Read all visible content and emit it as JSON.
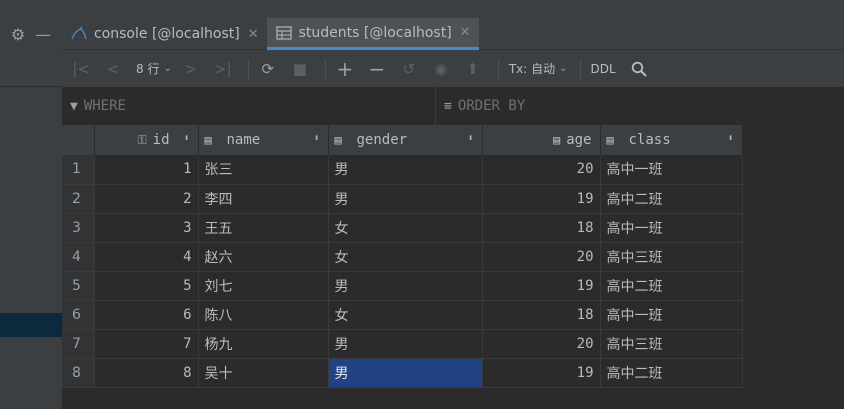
{
  "tabs": [
    {
      "label": "console [@localhost]",
      "icon": "mysql-icon",
      "active": false
    },
    {
      "label": "students [@localhost]",
      "icon": "table-icon",
      "active": true
    }
  ],
  "toolbar": {
    "rows_label": "8 行",
    "tx_label": "Tx: 自动",
    "ddl_label": "DDL"
  },
  "filter": {
    "where_label": "WHERE",
    "order_label": "ORDER BY"
  },
  "grid": {
    "columns": [
      "id",
      "name",
      "gender",
      "age",
      "class"
    ],
    "rows": [
      {
        "num": "1",
        "id": "1",
        "name": "张三",
        "gender": "男",
        "age": "20",
        "class": "高中一班"
      },
      {
        "num": "2",
        "id": "2",
        "name": "李四",
        "gender": "男",
        "age": "19",
        "class": "高中二班"
      },
      {
        "num": "3",
        "id": "3",
        "name": "王五",
        "gender": "女",
        "age": "18",
        "class": "高中一班"
      },
      {
        "num": "4",
        "id": "4",
        "name": "赵六",
        "gender": "女",
        "age": "20",
        "class": "高中三班"
      },
      {
        "num": "5",
        "id": "5",
        "name": "刘七",
        "gender": "男",
        "age": "19",
        "class": "高中二班"
      },
      {
        "num": "6",
        "id": "6",
        "name": "陈八",
        "gender": "女",
        "age": "18",
        "class": "高中一班"
      },
      {
        "num": "7",
        "id": "7",
        "name": "杨九",
        "gender": "男",
        "age": "20",
        "class": "高中三班"
      },
      {
        "num": "8",
        "id": "8",
        "name": "吴十",
        "gender": "男",
        "age": "19",
        "class": "高中二班"
      }
    ]
  },
  "colors": {
    "accent": "#4a88c7",
    "selection": "#214283",
    "background": "#2b2b2b",
    "panel": "#3c3f41"
  }
}
